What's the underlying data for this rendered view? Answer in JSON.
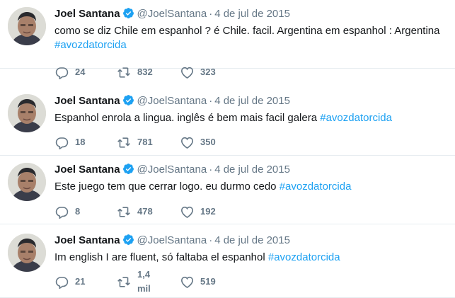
{
  "tweets": [
    {
      "name": "Joel Santana",
      "handle": "@JoelSantana",
      "separator": "·",
      "date": "4 de jul de 2015",
      "text": "como se diz Chile em espanhol ? é Chile. facil. Argentina em espanhol : Argentina",
      "hashtag": "#avozdatorcida",
      "replies": "24",
      "retweets": "832",
      "likes": "323"
    },
    {
      "name": "Joel Santana",
      "handle": "@JoelSantana",
      "separator": "·",
      "date": "4 de jul de 2015",
      "text": "Espanhol enrola a lingua. inglês é bem mais facil galera ",
      "hashtag": "#avozdatorcida",
      "replies": "18",
      "retweets": "781",
      "likes": "350"
    },
    {
      "name": "Joel Santana",
      "handle": "@JoelSantana",
      "separator": "·",
      "date": "4 de jul de 2015",
      "text": "Este juego tem que cerrar logo. eu durmo cedo ",
      "hashtag": "#avozdatorcida",
      "replies": "8",
      "retweets": "478",
      "likes": "192"
    },
    {
      "name": "Joel Santana",
      "handle": "@JoelSantana",
      "separator": "·",
      "date": "4 de jul de 2015",
      "text": "Im english I are fluent, só faltaba el espanhol ",
      "hashtag": "#avozdatorcida",
      "replies": "21",
      "retweets": "1,4 mil",
      "likes": "519"
    }
  ],
  "icons": {
    "verified": "verified-badge-icon",
    "reply": "reply-icon",
    "retweet": "retweet-icon",
    "like": "heart-icon"
  },
  "colors": {
    "accent": "#1da1f2",
    "muted": "#657786",
    "text": "#14171a",
    "border": "#e6ecf0"
  }
}
